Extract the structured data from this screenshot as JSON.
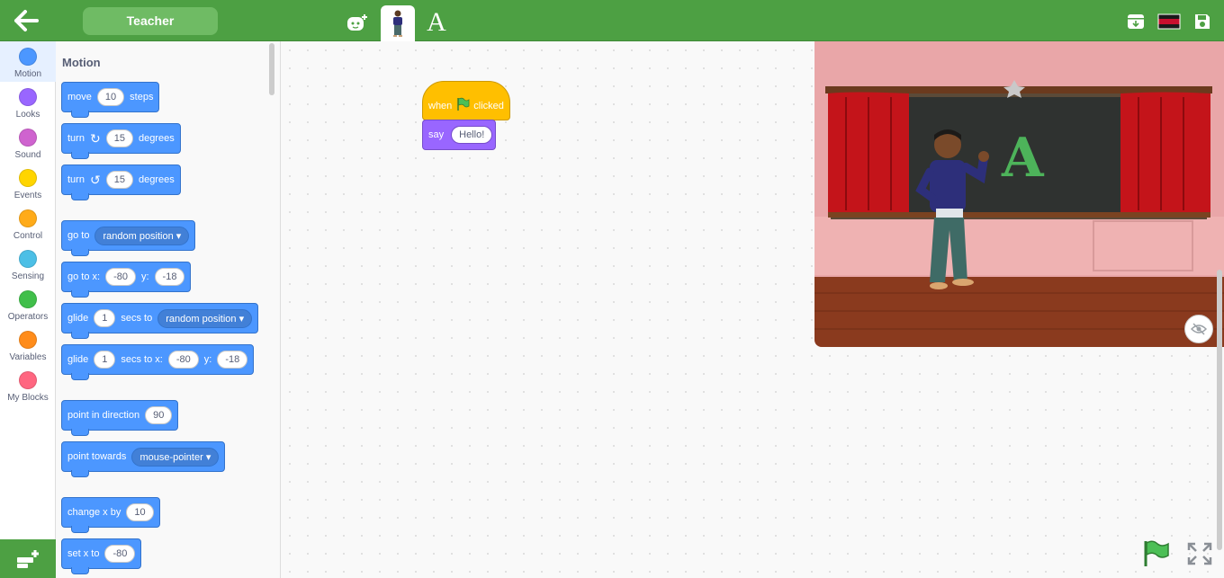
{
  "header": {
    "back_label": "",
    "sprite_name": "Teacher",
    "tabs": [
      {
        "name": "add-sprite-tab"
      },
      {
        "name": "teacher-sprite-tab"
      },
      {
        "name": "letter-a-sprite-tab",
        "label": "A"
      }
    ],
    "right_icons": [
      "archive-download-icon",
      "flag-icon",
      "save-icon"
    ]
  },
  "categories": [
    {
      "label": "Motion",
      "color": "#4c97ff"
    },
    {
      "label": "Looks",
      "color": "#9966ff"
    },
    {
      "label": "Sound",
      "color": "#cf63cf"
    },
    {
      "label": "Events",
      "color": "#ffd500"
    },
    {
      "label": "Control",
      "color": "#ffab19"
    },
    {
      "label": "Sensing",
      "color": "#4cbfe6"
    },
    {
      "label": "Operators",
      "color": "#40bf4a"
    },
    {
      "label": "Variables",
      "color": "#ff8c1a"
    },
    {
      "label": "My Blocks",
      "color": "#ff6680"
    }
  ],
  "palette": {
    "title": "Motion",
    "blocks": {
      "move": {
        "a": "move",
        "v": "10",
        "b": "steps"
      },
      "turn_right": {
        "a": "turn",
        "v": "15",
        "b": "degrees"
      },
      "turn_left": {
        "a": "turn",
        "v": "15",
        "b": "degrees"
      },
      "goto": {
        "a": "go to",
        "dd": "random position"
      },
      "goto_xy": {
        "a": "go to x:",
        "x": "-80",
        "ylabel": "y:",
        "y": "-18"
      },
      "glide": {
        "a": "glide",
        "v": "1",
        "b": "secs to",
        "dd": "random position"
      },
      "glide_xy": {
        "a": "glide",
        "v": "1",
        "b": "secs to x:",
        "x": "-80",
        "ylabel": "y:",
        "y": "-18"
      },
      "point_dir": {
        "a": "point in direction",
        "v": "90"
      },
      "point_towards": {
        "a": "point towards",
        "dd": "mouse-pointer"
      },
      "change_x": {
        "a": "change x by",
        "v": "10"
      },
      "set_x": {
        "a": "set x to",
        "v": "-80"
      }
    }
  },
  "script": {
    "hat": {
      "a": "when",
      "b": "clicked"
    },
    "say": {
      "a": "say",
      "v": "Hello!"
    }
  },
  "stage": {
    "board_letter": "A"
  }
}
